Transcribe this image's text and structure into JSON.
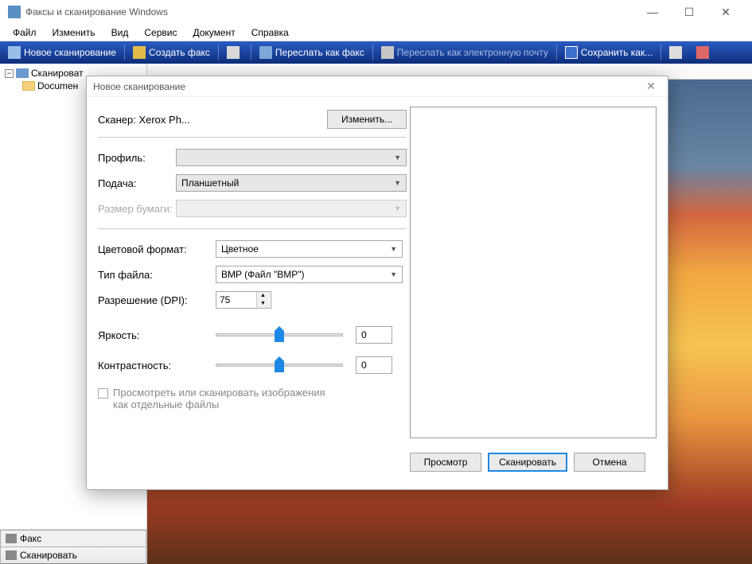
{
  "window": {
    "title": "Факсы и сканирование Windows"
  },
  "menu": {
    "file": "Файл",
    "edit": "Изменить",
    "view": "Вид",
    "service": "Сервис",
    "document": "Документ",
    "help": "Справка"
  },
  "toolbar": {
    "new_scan": "Новое сканирование",
    "create_fax": "Создать факс",
    "forward_fax": "Переслать как факс",
    "forward_email": "Переслать как электронную почту",
    "save_as": "Сохранить как..."
  },
  "tree": {
    "root": "Сканироват",
    "child": "Documен"
  },
  "bottom_tabs": {
    "fax": "Факс",
    "scan": "Сканировать"
  },
  "dialog": {
    "title": "Новое сканирование",
    "scanner_label": "Сканер: Xerox Ph...",
    "change_btn": "Изменить...",
    "profile_label": "Профиль:",
    "profile_value": "",
    "source_label": "Подача:",
    "source_value": "Планшетный",
    "paper_label": "Размер бумаги:",
    "paper_value": "",
    "color_label": "Цветовой формат:",
    "color_value": "Цветное",
    "filetype_label": "Тип файла:",
    "filetype_value": "BMP (Файл \"BMP\")",
    "dpi_label": "Разрешение (DPI):",
    "dpi_value": "75",
    "brightness_label": "Яркость:",
    "brightness_value": "0",
    "contrast_label": "Контрастность:",
    "contrast_value": "0",
    "checkbox_label": "Просмотреть или сканировать изображения как отдельные файлы",
    "preview_btn": "Просмотр",
    "scan_btn": "Сканировать",
    "cancel_btn": "Отмена"
  }
}
